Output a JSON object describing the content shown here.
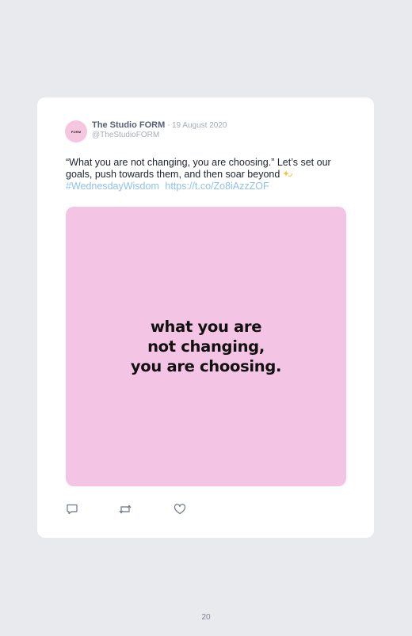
{
  "tweet": {
    "avatar_text": "FORM",
    "author_name": "The Studio FORM",
    "separator": "·",
    "date": "19 August 2020",
    "handle": "@TheStudioFORM",
    "body_text": "“What you are not changing, you are choosing.” Let’s set our goals, push towards them, and then soar beyond",
    "emoji_icon": "sparkle-icon",
    "hashtag": "#WednesdayWisdom",
    "link": "https://t.co/Zo8iAzzZOF",
    "image": {
      "lines": [
        "what you are",
        "not changing,",
        "you are choosing."
      ],
      "background_color": "#f4c4e4"
    },
    "actions": {
      "reply_icon": "reply-icon",
      "retweet_icon": "retweet-icon",
      "like_icon": "heart-icon"
    }
  },
  "page": {
    "number": "20"
  }
}
